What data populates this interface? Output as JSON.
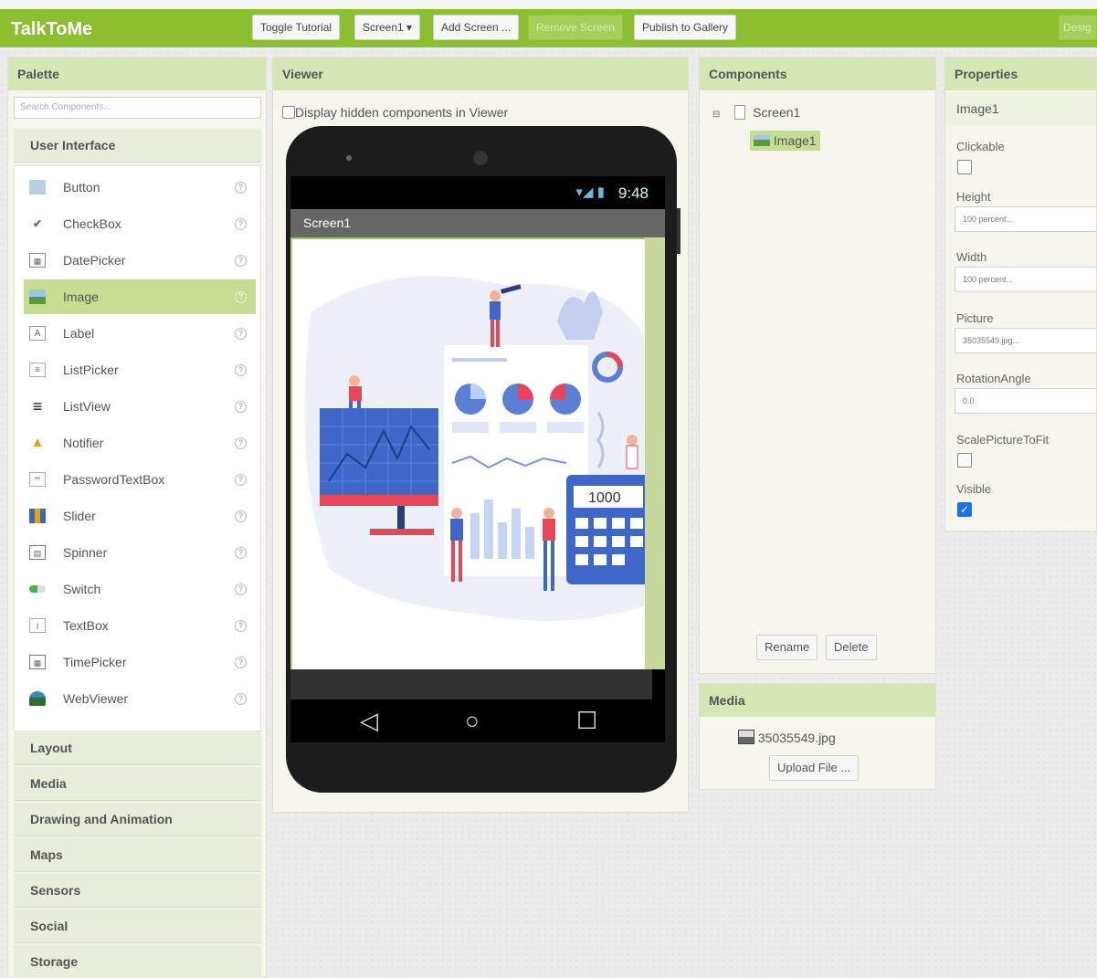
{
  "app": {
    "title": "TalkToMe"
  },
  "toolbar": {
    "toggle_tutorial": "Toggle Tutorial",
    "screen_select": "Screen1 ▾",
    "add_screen": "Add Screen ...",
    "remove_screen": "Remove Screen",
    "publish": "Publish to Gallery",
    "designer": "Desig"
  },
  "palette": {
    "title": "Palette",
    "search_placeholder": "Search Components...",
    "user_interface": "User Interface",
    "items": [
      {
        "label": "Button",
        "icon": "button-icon"
      },
      {
        "label": "CheckBox",
        "icon": "checkbox-icon"
      },
      {
        "label": "DatePicker",
        "icon": "datepicker-icon"
      },
      {
        "label": "Image",
        "icon": "image-icon"
      },
      {
        "label": "Label",
        "icon": "label-icon"
      },
      {
        "label": "ListPicker",
        "icon": "listpicker-icon"
      },
      {
        "label": "ListView",
        "icon": "listview-icon"
      },
      {
        "label": "Notifier",
        "icon": "notifier-icon"
      },
      {
        "label": "PasswordTextBox",
        "icon": "password-icon"
      },
      {
        "label": "Slider",
        "icon": "slider-icon"
      },
      {
        "label": "Spinner",
        "icon": "spinner-icon"
      },
      {
        "label": "Switch",
        "icon": "switch-icon"
      },
      {
        "label": "TextBox",
        "icon": "textbox-icon"
      },
      {
        "label": "TimePicker",
        "icon": "timepicker-icon"
      },
      {
        "label": "WebViewer",
        "icon": "webviewer-icon"
      }
    ],
    "help_glyph": "?",
    "categories": [
      "Layout",
      "Media",
      "Drawing and Animation",
      "Maps",
      "Sensors",
      "Social",
      "Storage"
    ]
  },
  "viewer": {
    "title": "Viewer",
    "hidden_label": "Display hidden components in Viewer",
    "status_time": "9:48",
    "status_icons": "▾◢ ▮",
    "screen_title": "Screen1",
    "calc_display": "1000"
  },
  "components": {
    "title": "Components",
    "root": "Screen1",
    "child": "Image1",
    "rename": "Rename",
    "delete": "Delete"
  },
  "media": {
    "title": "Media",
    "file": "35035549.jpg",
    "upload": "Upload File ..."
  },
  "properties": {
    "title": "Properties",
    "component": "Image1",
    "clickable_label": "Clickable",
    "height_label": "Height",
    "height_value": "100 percent...",
    "width_label": "Width",
    "width_value": "100 percent...",
    "picture_label": "Picture",
    "picture_value": "35035549.jpg...",
    "rotation_label": "RotationAngle",
    "rotation_value": "0.0",
    "scale_label": "ScalePictureToFit",
    "visible_label": "Visible",
    "visible_mark": "✓"
  },
  "colors": {
    "accent": "#8cbf2f",
    "panel_head": "#d6e6b5",
    "selected": "#c6dd92"
  }
}
